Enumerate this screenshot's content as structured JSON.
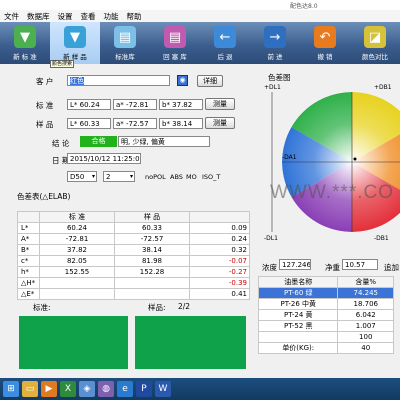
{
  "window": {
    "title": "配色达8.0"
  },
  "menu": [
    "文件",
    "数据库",
    "设置",
    "查看",
    "功能",
    "帮助"
  ],
  "toolbar": [
    {
      "label": "新 标 准",
      "icon": "paint-bucket-icon",
      "color": "#4caf50",
      "glyph": "▼"
    },
    {
      "label": "新 样 品",
      "icon": "paint-can-icon",
      "color": "#3aa0d8",
      "glyph": "▼"
    },
    {
      "label": "标准库",
      "icon": "standard-library-icon",
      "color": "#7cc0e8",
      "glyph": "▤"
    },
    {
      "label": "回 塞 库",
      "icon": "sample-library-icon",
      "color": "#c05bb0",
      "glyph": "▤"
    },
    {
      "label": "后 退",
      "icon": "back-arrow-icon",
      "color": "#3d8ad8",
      "glyph": "←"
    },
    {
      "label": "前 进",
      "icon": "forward-arrow-icon",
      "color": "#2f6fc0",
      "glyph": "→"
    },
    {
      "label": "撤 销",
      "icon": "undo-icon",
      "color": "#e87b1e",
      "glyph": "↶"
    },
    {
      "label": "颜色对比",
      "icon": "color-compare-icon",
      "color": "#d6c23a",
      "glyph": "◪"
    }
  ],
  "tooltip": "颜色搜索",
  "form": {
    "customer_label": "客 户",
    "customer_value": "红色",
    "detail_btn": "详细",
    "standard_label": "标 准",
    "sample_label": "样 品",
    "standard": {
      "L": "L* 60.24",
      "a": "a* -72.81",
      "b": "b* 37.82"
    },
    "sample": {
      "L": "L* 60.33",
      "a": "a* -72.57",
      "b": "b* 38.14"
    },
    "measure_btn": "测量",
    "conclusion_label": "结 论",
    "verdict": "合格",
    "comment": "明, 少绿, 偏黄",
    "date_label": "日 期",
    "date_value": "2015/10/12 11:25:0",
    "illuminant": "D50",
    "observer": "2",
    "options": [
      "noPOL",
      "ABS",
      "MO",
      "ISO_T"
    ]
  },
  "diff": {
    "title": "色差表(△ELAB)",
    "headers": [
      "",
      "标 准",
      "样 品",
      ""
    ],
    "rows": [
      {
        "name": "L*",
        "std": "60.24",
        "smp": "60.33",
        "d": "0.09",
        "neg": false
      },
      {
        "name": "A*",
        "std": "-72.81",
        "smp": "-72.57",
        "d": "0.24",
        "neg": false
      },
      {
        "name": "B*",
        "std": "37.82",
        "smp": "38.14",
        "d": "0.32",
        "neg": false
      },
      {
        "name": "c*",
        "std": "82.05",
        "smp": "81.98",
        "d": "-0.07",
        "neg": true
      },
      {
        "name": "h*",
        "std": "152.55",
        "smp": "152.28",
        "d": "-0.27",
        "neg": true
      },
      {
        "name": "△H*",
        "std": "",
        "smp": "",
        "d": "-0.39",
        "neg": true
      },
      {
        "name": "△E*",
        "std": "",
        "smp": "",
        "d": "0.41",
        "neg": false
      }
    ]
  },
  "swatch": {
    "std_label": "标准:",
    "smp_label": "样品:",
    "page": "2/2",
    "color": "#0fa24a"
  },
  "colorspace": {
    "title": "色差图",
    "top": "+DL1",
    "bottom": "-DL1",
    "left": "-DA1",
    "right": "+DB1",
    "bottom_right": "-DB1"
  },
  "watermark": "WWW.***.CO",
  "recipe": {
    "concentration_label": "浓度",
    "concentration": "127.246",
    "net_label": "净重",
    "net": "10.57",
    "add_label": "追加",
    "headers": [
      "油墨名称",
      "含量%"
    ],
    "rows": [
      [
        "PT-60 绿",
        "74.245"
      ],
      [
        "PT-26 中黄",
        "18.706"
      ],
      [
        "PT-24 黄",
        "6.042"
      ],
      [
        "PT-52 黑",
        "1.007"
      ],
      [
        "",
        "100"
      ],
      [
        "单价(KG):",
        "40"
      ]
    ]
  },
  "taskbar": [
    {
      "icon": "windows-start-icon",
      "color": "#3c8de0",
      "glyph": "⊞"
    },
    {
      "icon": "explorer-icon",
      "color": "#e0b040",
      "glyph": "▭"
    },
    {
      "icon": "media-player-icon",
      "color": "#e07a20",
      "glyph": "▶"
    },
    {
      "icon": "excel-icon",
      "color": "#2e8b3e",
      "glyph": "X"
    },
    {
      "icon": "network-icon",
      "color": "#5a8fd0",
      "glyph": "◈"
    },
    {
      "icon": "app-icon",
      "color": "#7f5fb0",
      "glyph": "◍"
    },
    {
      "icon": "ie-icon",
      "color": "#2a7ad0",
      "glyph": "e"
    },
    {
      "icon": "photoshop-icon",
      "color": "#1f4aa0",
      "glyph": "P"
    },
    {
      "icon": "word-icon",
      "color": "#2a5ab0",
      "glyph": "W"
    }
  ]
}
